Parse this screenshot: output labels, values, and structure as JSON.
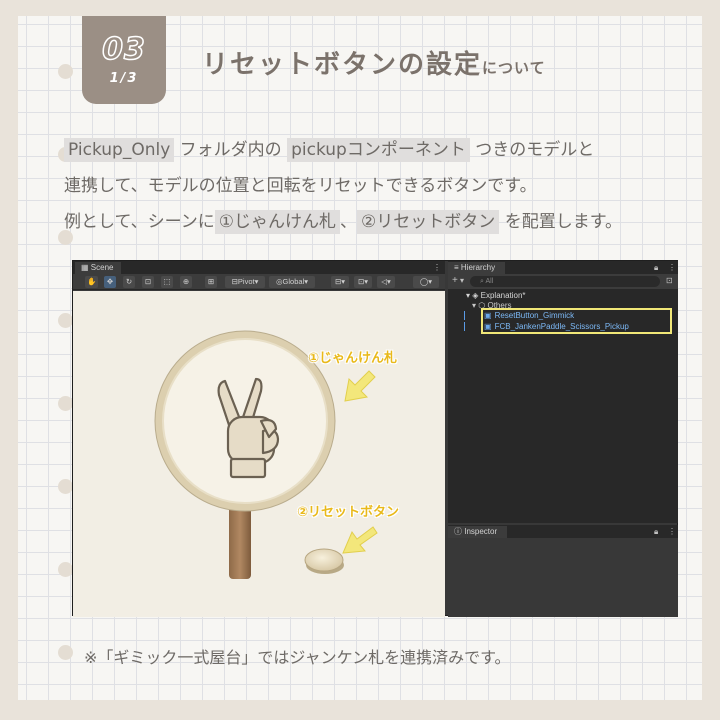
{
  "header": {
    "number": "03",
    "page": "1/3",
    "title_main": "リセットボタンの設定",
    "title_small": "について"
  },
  "description": {
    "line1": {
      "tag1": "Pickup_Only",
      "text1": " フォルダ内の ",
      "tag2": "pickupコンポーネント",
      "text2": " つきのモデルと"
    },
    "line2": "連携して、モデルの位置と回転をリセットできるボタンです。",
    "line3": {
      "text1": "例として、シーンに",
      "tag1": "①じゃんけん札",
      "text2": "、",
      "tag2": "②リセットボタン",
      "text3": " を配置します。"
    }
  },
  "unity": {
    "scene": {
      "tab_label": "Scene",
      "pivot_label": "Pivot",
      "global_label": "Global",
      "label_paddle": "①じゃんけん札",
      "label_reset": "②リセットボタン"
    },
    "hierarchy": {
      "tab_label": "Hierarchy",
      "add_button": "+",
      "search_placeholder": "All",
      "scene_root": "Explanation*",
      "group": "Others",
      "items": [
        {
          "label": "ResetButton_Gimmick"
        },
        {
          "label": "FCB_JankenPaddle_Scissors_Pickup"
        }
      ]
    },
    "inspector": {
      "tab_label": "Inspector"
    }
  },
  "note": "※「ギミック一式屋台」ではジャンケン札を連携済みです。",
  "colors": {
    "accent": "#9b8f85",
    "highlight": "#e0dedd",
    "label_yellow": "#e9b91a",
    "selection": "#f1e778"
  }
}
